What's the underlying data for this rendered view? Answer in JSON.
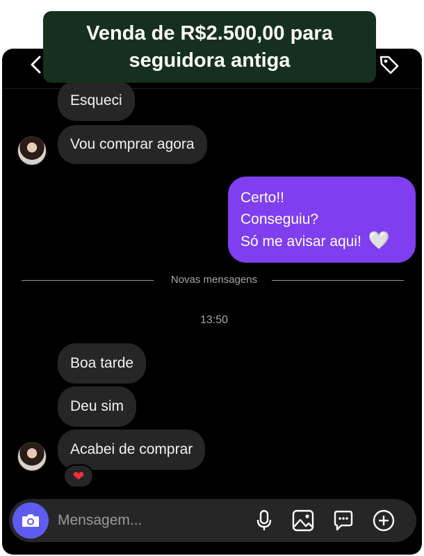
{
  "banner": {
    "line1": "Venda de R$2.500,00 para",
    "line2": "seguidora antiga"
  },
  "messages_before": [
    {
      "text": "Esqueci"
    },
    {
      "text": "Vou comprar agora"
    }
  ],
  "outgoing": {
    "lines": [
      "Certo!!",
      "Conseguiu?",
      "Só me avisar aqui! "
    ],
    "emoji": "🤍"
  },
  "divider": {
    "label": "Novas mensagens"
  },
  "timestamp": "13:50",
  "messages_after": [
    {
      "text": "Boa tarde"
    },
    {
      "text": "Deu sim"
    },
    {
      "text": "Acabei de comprar"
    }
  ],
  "reaction": {
    "emoji": "❤"
  },
  "composer": {
    "placeholder": "Mensagem..."
  },
  "icons": [
    "back-icon",
    "tag-icon",
    "camera-icon",
    "microphone-icon",
    "image-icon",
    "sticker-icon",
    "plus-icon"
  ],
  "colors": {
    "background": "#000000",
    "incoming_bubble": "#262626",
    "outgoing_bubble": "#7f3ff0",
    "camera_button": "#5e5cf0",
    "banner": "#16301f"
  }
}
